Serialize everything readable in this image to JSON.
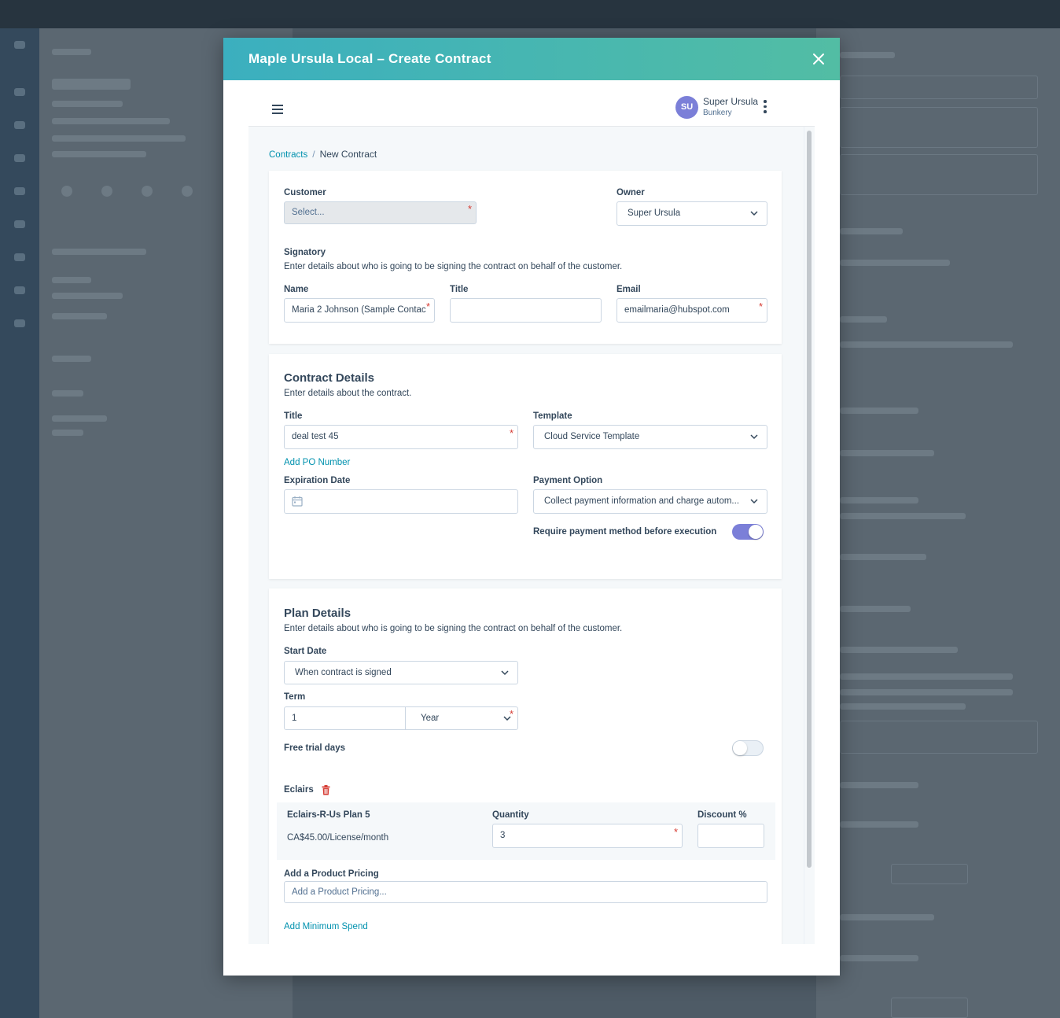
{
  "modal": {
    "title": "Maple Ursula Local – Create Contract"
  },
  "user": {
    "initials": "SU",
    "name": "Super Ursula",
    "org": "Bunkery"
  },
  "breadcrumb": {
    "parent": "Contracts",
    "separator": "/",
    "current": "New Contract"
  },
  "customer_section": {
    "customer_label": "Customer",
    "customer_placeholder": "Select...",
    "owner_label": "Owner",
    "owner_value": "Super Ursula",
    "signatory_title": "Signatory",
    "signatory_desc": "Enter details about who is going to be signing the contract on behalf of the customer.",
    "name_label": "Name",
    "name_value": "Maria 2 Johnson (Sample Contac",
    "title_label": "Title",
    "title_value": "",
    "email_label": "Email",
    "email_value": "emailmaria@hubspot.com"
  },
  "contract_details": {
    "heading": "Contract Details",
    "desc": "Enter details about the contract.",
    "title_label": "Title",
    "title_value": "deal test 45",
    "template_label": "Template",
    "template_value": "Cloud Service Template",
    "add_po_link": "Add PO Number",
    "expiration_label": "Expiration Date",
    "expiration_value": "",
    "payment_option_label": "Payment Option",
    "payment_option_value": "Collect payment information and charge autom...",
    "require_payment_label": "Require payment method before execution",
    "require_payment_on": true
  },
  "plan_details": {
    "heading": "Plan Details",
    "desc": "Enter details about who is going to be signing the contract on behalf of the customer.",
    "start_date_label": "Start Date",
    "start_date_value": "When contract is signed",
    "term_label": "Term",
    "term_value": "1",
    "term_unit": "Year",
    "free_trial_label": "Free trial days",
    "free_trial_on": false,
    "product_group": "Eclairs",
    "plan_name": "Eclairs-R-Us Plan 5",
    "plan_price": "CA$45.00/License/month",
    "quantity_label": "Quantity",
    "quantity_value": "3",
    "discount_label": "Discount %",
    "discount_value": "",
    "add_pricing_label": "Add a Product Pricing",
    "add_pricing_placeholder": "Add a Product Pricing...",
    "add_min_spend_link": "Add Minimum Spend"
  },
  "icons": {
    "close": "close-icon",
    "menu": "hamburger-menu-icon",
    "more": "kebab-menu-icon",
    "calendar": "calendar-icon",
    "delete": "trash-icon",
    "dropdown": "chevron-down-icon"
  },
  "colors": {
    "header_gradient_start": "#3bafbf",
    "header_gradient_end": "#52bda4",
    "link": "#0091ae",
    "required": "#d63b33",
    "toggle_on": "#7b7fd8",
    "avatar": "#7b7fd8"
  }
}
